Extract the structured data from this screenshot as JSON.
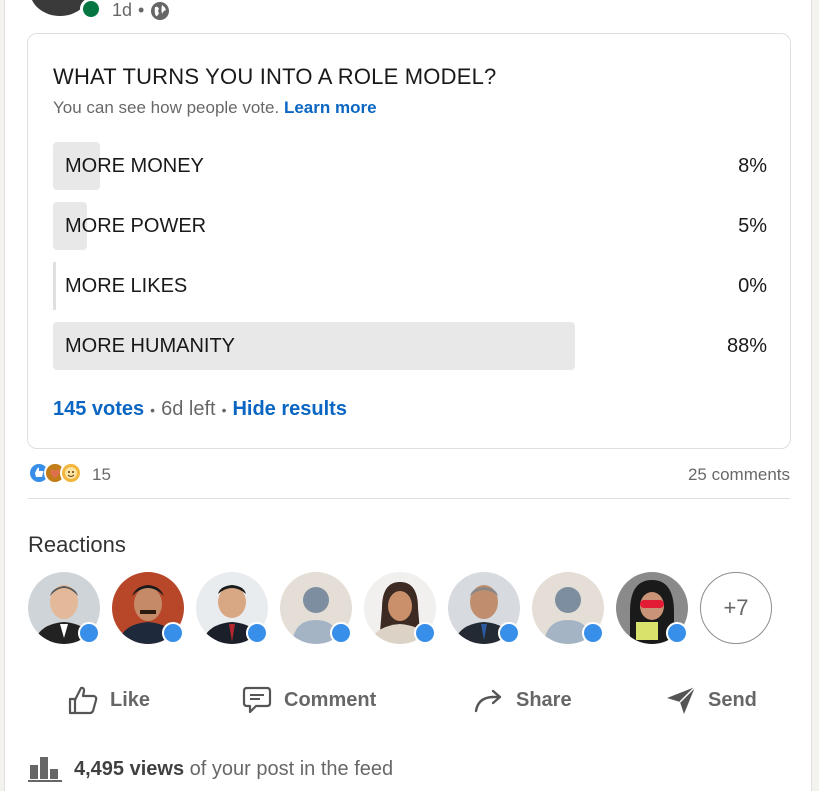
{
  "post": {
    "age": "1d",
    "visibility_icon": "globe-icon"
  },
  "poll": {
    "question": "WHAT TURNS YOU INTO A ROLE MODEL?",
    "note": "You can see how people vote.",
    "learn_more": "Learn more",
    "options": [
      {
        "label": "MORE MONEY",
        "percent_text": "8%",
        "percent": 8
      },
      {
        "label": "MORE POWER",
        "percent_text": "5%",
        "percent": 5
      },
      {
        "label": "MORE LIKES",
        "percent_text": "0%",
        "percent": 0
      },
      {
        "label": "MORE HUMANITY",
        "percent_text": "88%",
        "percent": 88
      }
    ],
    "votes": "145 votes",
    "time_left": "6d left",
    "hide_results": "Hide results"
  },
  "social": {
    "reaction_count": "15",
    "reaction_icons": [
      "like-icon",
      "support-icon",
      "funny-icon"
    ],
    "comments": "25 comments"
  },
  "reactions": {
    "title": "Reactions",
    "more": "+7"
  },
  "actions": {
    "like": "Like",
    "comment": "Comment",
    "share": "Share",
    "send": "Send"
  },
  "views": {
    "count": "4,495 views",
    "suffix": "of your post in the feed"
  },
  "colors": {
    "link": "#0a66c2",
    "like_badge": "#378fe9",
    "online": "#057642",
    "poll_bar": "#e8e8e8"
  }
}
